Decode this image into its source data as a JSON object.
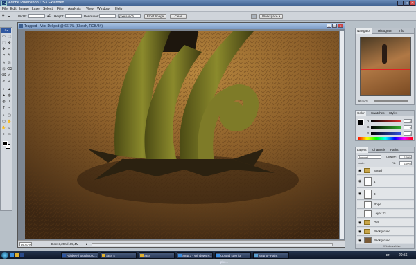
{
  "app": {
    "title": "Adobe Photoshop CS3 Extended",
    "icon": "ps-logo-icon",
    "logo_text": "Ps"
  },
  "window_controls": {
    "minimize": "–",
    "maximize": "□",
    "close": "✕"
  },
  "menu": [
    "File",
    "Edit",
    "Image",
    "Layer",
    "Select",
    "Filter",
    "Analysis",
    "View",
    "Window",
    "Help"
  ],
  "options_bar": {
    "width_label": "Width:",
    "height_label": "Height:",
    "resolution_label": "Resolution:",
    "resolution_unit": "pixels/inch",
    "front_image_button": "Front Image",
    "clear_button": "Clear",
    "workspace_button": "Workspace ▾"
  },
  "document": {
    "title": "Trapped - Vtor Del.psd @ 66,7% (Sketch, RGB/8#)",
    "zoom": "66,67%",
    "doc_size": "Doc: 3,29M/165,4M"
  },
  "navigator": {
    "tabs": [
      "Navigator",
      "Histogram",
      "Info"
    ],
    "zoom": "66,67%"
  },
  "color_panel": {
    "tabs": [
      "Color",
      "Swatches",
      "Styles"
    ],
    "channels": [
      {
        "label": "R",
        "value": "0",
        "color": "#e03030"
      },
      {
        "label": "G",
        "value": "0",
        "color": "#30b030"
      },
      {
        "label": "B",
        "value": "0",
        "color": "#3050e0"
      }
    ]
  },
  "layers_panel": {
    "tabs": [
      "Layers",
      "Channels",
      "Paths"
    ],
    "blend_mode": "Normal",
    "opacity_label": "Opacity:",
    "opacity": "100%",
    "lock_label": "Lock:",
    "fill_label": "Fill:",
    "fill": "100%",
    "layers": [
      {
        "name": "Sketch",
        "visible": true,
        "type": "group"
      },
      {
        "name": "4",
        "visible": true,
        "type": "layer"
      },
      {
        "name": "3",
        "visible": true,
        "type": "layer"
      },
      {
        "name": "Rope",
        "visible": false,
        "type": "layer"
      },
      {
        "name": "Layer 23",
        "visible": false,
        "type": "layer"
      },
      {
        "name": "Girl",
        "visible": true,
        "type": "group"
      },
      {
        "name": "Background",
        "visible": true,
        "type": "group"
      },
      {
        "name": "Background",
        "visible": true,
        "type": "background"
      }
    ]
  },
  "watermark": "Windows Live",
  "taskbar": {
    "items": [
      "Adobe Photoshop C...",
      "SBS 4",
      "SBS",
      "Step 3 - Windows P...",
      "Upload step for pho...",
      "Step 5 - Paint"
    ],
    "locale": "EN",
    "clock": "20:56"
  },
  "colors": {
    "accent": "#3d5f8e",
    "active_tab": "#e8ebee",
    "taskbar": "#1a2438"
  }
}
